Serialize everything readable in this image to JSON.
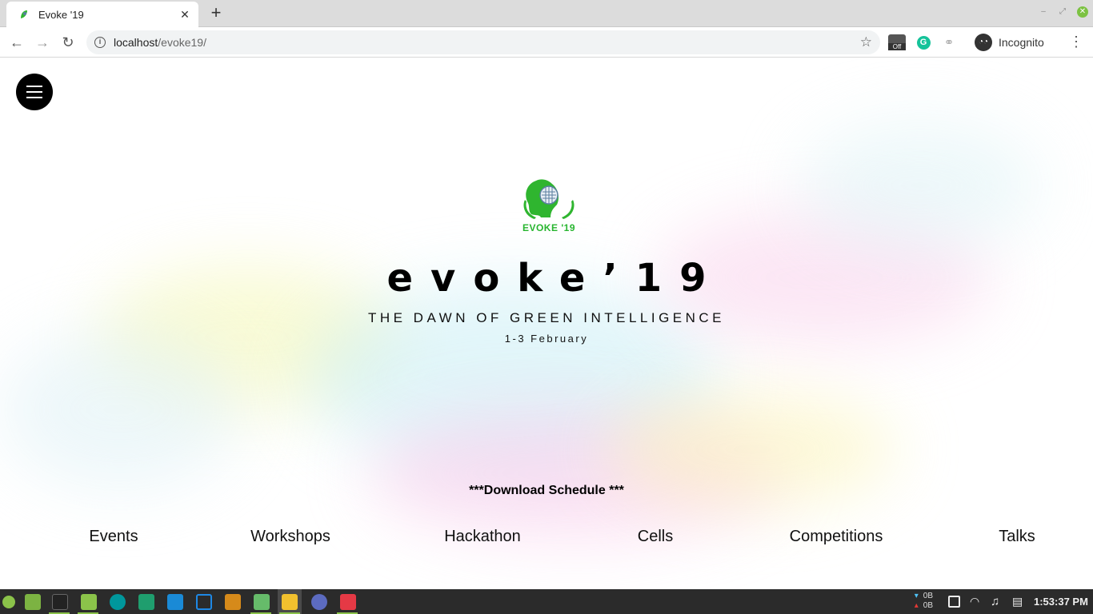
{
  "browser": {
    "tab_title": "Evoke '19",
    "url_host": "localhost",
    "url_path": "/evoke19/",
    "ext_off_label": "Off",
    "ext_grammarly_label": "G",
    "incognito_label": "Incognito"
  },
  "page": {
    "logo_text": "EVOKE '19",
    "title": "evoke’19",
    "subtitle": "THE DAWN OF GREEN INTELLIGENCE",
    "date": "1-3 February",
    "download_link": "***Download Schedule ***",
    "nav": [
      "Events",
      "Workshops",
      "Hackathon",
      "Cells",
      "Competitions",
      "Talks"
    ],
    "colors": {
      "logo_green": "#27b52f",
      "title": "#000000"
    }
  },
  "taskbar": {
    "net_up": "0B",
    "net_down": "0B",
    "clock": "1:53:37 PM"
  }
}
